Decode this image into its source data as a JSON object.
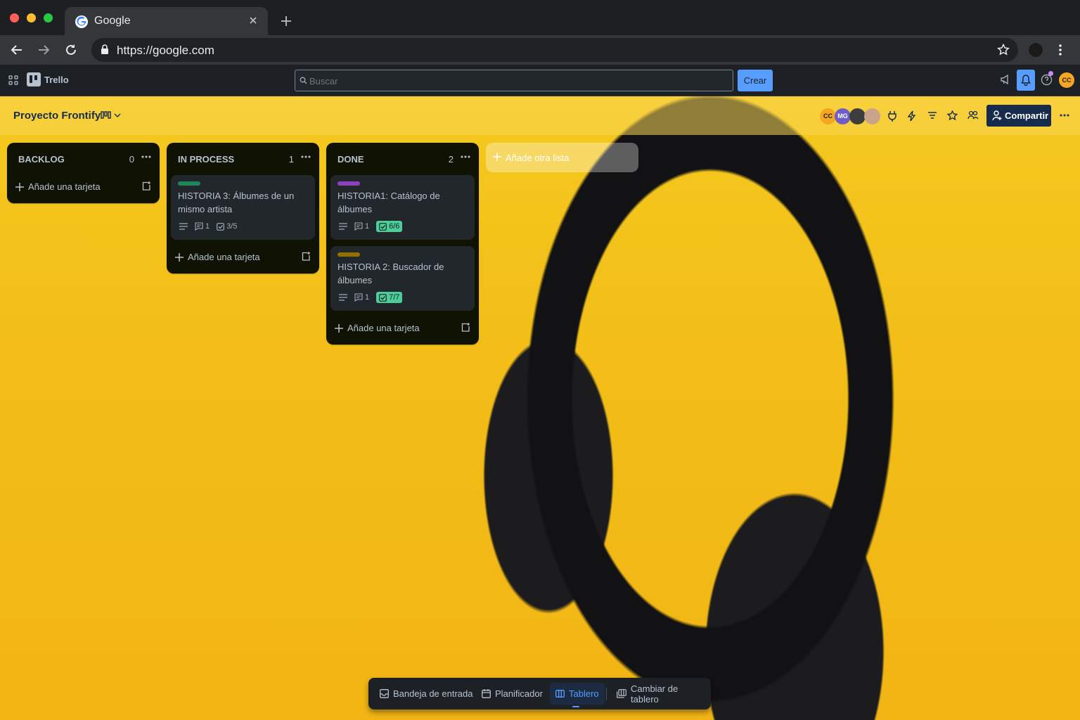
{
  "browser": {
    "tab_title": "Google",
    "url": "https://google.com"
  },
  "trello": {
    "app_name": "Trello",
    "search_placeholder": "Buscar",
    "create_label": "Crear",
    "avatar_initials": "CC"
  },
  "board": {
    "title": "Proyecto Frontify",
    "member_avatars": [
      "CC",
      "MG"
    ],
    "share_label": "Compartir",
    "add_list_label": "Añade otra lista",
    "lists": [
      {
        "title": "BACKLOG",
        "count": "0",
        "add_card_label": "Añade una tarjeta",
        "cards": []
      },
      {
        "title": "IN PROCESS",
        "count": "1",
        "add_card_label": "Añade una tarjeta",
        "cards": [
          {
            "label_color": "#1f845a",
            "title": "HISTORIA 3: Álbumes de un mismo artista",
            "comments": "1",
            "checklist": "3/5",
            "checklist_complete": false
          }
        ]
      },
      {
        "title": "DONE",
        "count": "2",
        "add_card_label": "Añade una tarjeta",
        "cards": [
          {
            "label_color": "#8f3fbe",
            "title": "HISTORIA1: Catálogo de álbumes",
            "comments": "1",
            "checklist": "6/6",
            "checklist_complete": true
          },
          {
            "label_color": "#946f00",
            "title": "HISTORIA 2: Buscador de álbumes",
            "comments": "1",
            "checklist": "7/7",
            "checklist_complete": true
          }
        ]
      }
    ]
  },
  "switcher": {
    "inbox": "Bandeja de entrada",
    "planner": "Planificador",
    "board": "Tablero",
    "switch_board": "Cambiar de tablero"
  }
}
